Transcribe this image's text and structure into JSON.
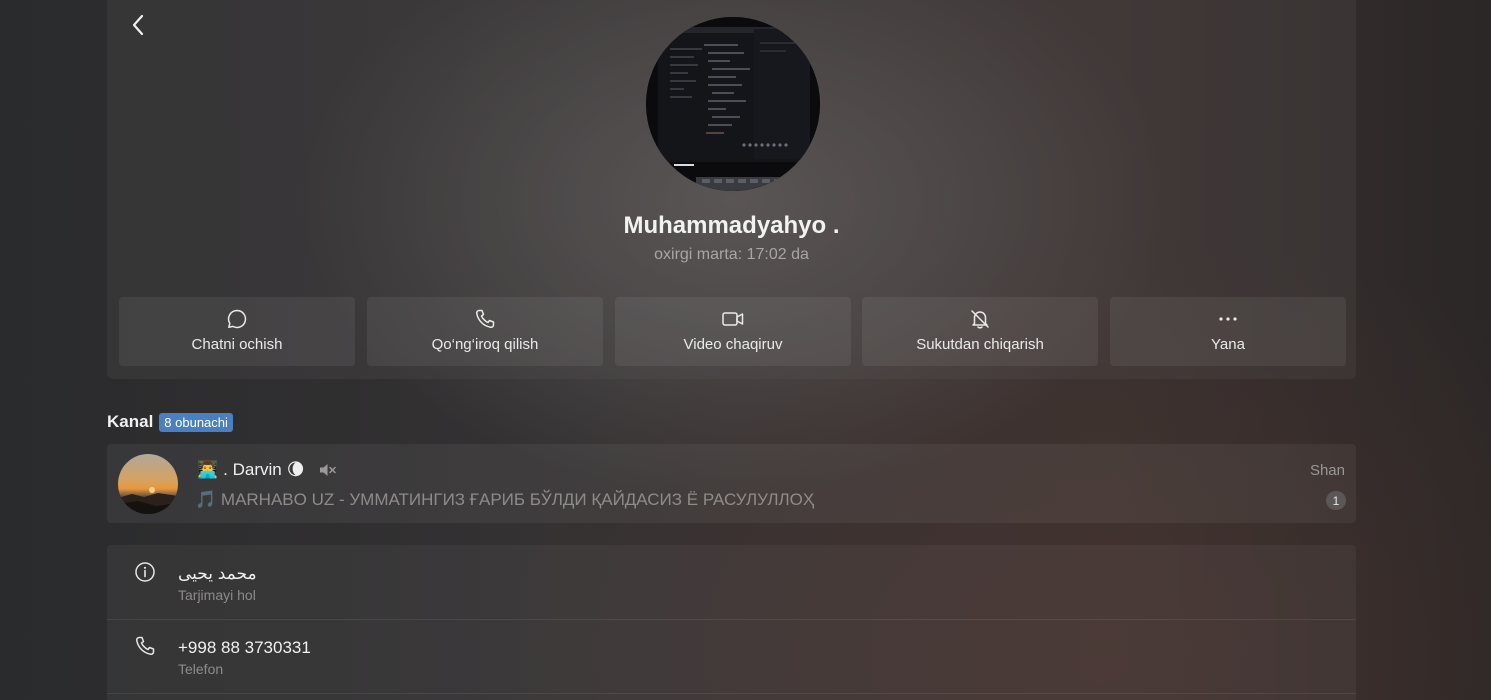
{
  "profile": {
    "name": "Muhammadyahyo .",
    "status": "oxirgi marta: 17:02 da"
  },
  "actions": [
    {
      "label": "Chatni ochish",
      "icon": "chat-bubble-icon"
    },
    {
      "label": "Qo‘ng‘iroq qilish",
      "icon": "phone-icon"
    },
    {
      "label": "Video chaqiruv",
      "icon": "video-camera-icon"
    },
    {
      "label": "Sukutdan chiqarish",
      "icon": "bell-off-icon"
    },
    {
      "label": "Yana",
      "icon": "more-dots-icon"
    }
  ],
  "channel_section": {
    "title": "Kanal",
    "badge": "8 obunachi"
  },
  "channel": {
    "emoji_prefix": "👨‍💻",
    "name": ". Darvin",
    "emoji_suffix": "🌘",
    "muted_icon": "speaker-muted-icon",
    "last_message_prefix": "🎵",
    "last_message": "MARHABO UZ - УММАТИНГИЗ ҒАРИБ БЎЛДИ ҚАЙДАСИЗ Ё РАСУЛУЛЛОҲ",
    "time": "Shan",
    "unread_count": "1"
  },
  "info": [
    {
      "value": "محمد يحيى",
      "caption": "Tarjimayi hol",
      "icon": "info-circle-icon"
    },
    {
      "value": "+998 88 3730331",
      "caption": "Telefon",
      "icon": "phone-icon"
    }
  ],
  "colors": {
    "badge": "#4a7fc0",
    "text_primary": "#f0f0f0",
    "text_secondary": "#a9a5a5"
  }
}
